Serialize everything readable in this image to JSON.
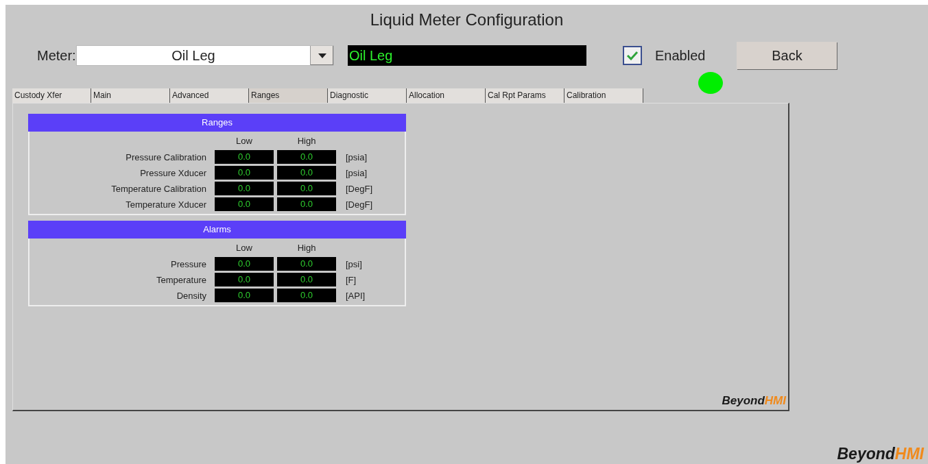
{
  "window": {
    "title": "Liquid Meter Configuration"
  },
  "meter": {
    "label": "Meter:",
    "value": "Oil Leg"
  },
  "meter_display": "Oil Leg",
  "enabled": {
    "label": "Enabled",
    "checked": true
  },
  "status_light": {
    "on": true
  },
  "back_button": "Back",
  "tabs": [
    {
      "label": "Custody Xfer",
      "selected": false
    },
    {
      "label": "Main",
      "selected": false
    },
    {
      "label": "Advanced",
      "selected": false
    },
    {
      "label": "Ranges",
      "selected": true
    },
    {
      "label": "Diagnostic",
      "selected": false
    },
    {
      "label": "Allocation",
      "selected": false
    },
    {
      "label": "Cal Rpt Params",
      "selected": false
    },
    {
      "label": "Calibration",
      "selected": false
    }
  ],
  "sections": [
    {
      "title": "Ranges",
      "columns": [
        "Low",
        "High"
      ],
      "rows": [
        {
          "label": "Pressure Calibration",
          "low": "0.0",
          "high": "0.0",
          "unit": "[psia]"
        },
        {
          "label": "Pressure Xducer",
          "low": "0.0",
          "high": "0.0",
          "unit": "[psia]"
        },
        {
          "label": "Temperature Calibration",
          "low": "0.0",
          "high": "0.0",
          "unit": "[DegF]"
        },
        {
          "label": "Temperature Xducer",
          "low": "0.0",
          "high": "0.0",
          "unit": "[DegF]"
        }
      ]
    },
    {
      "title": "Alarms",
      "columns": [
        "Low",
        "High"
      ],
      "rows": [
        {
          "label": "Pressure",
          "low": "0.0",
          "high": "0.0",
          "unit": "[psi]"
        },
        {
          "label": "Temperature",
          "low": "0.0",
          "high": "0.0",
          "unit": "[F]"
        },
        {
          "label": "Density",
          "low": "0.0",
          "high": "0.0",
          "unit": "[API]"
        }
      ]
    }
  ],
  "panel_logo": {
    "part_1": "Beyond",
    "part_2": "HMI"
  },
  "footer_logo": {
    "part_1": "Beyond",
    "part_2": "HMI"
  }
}
